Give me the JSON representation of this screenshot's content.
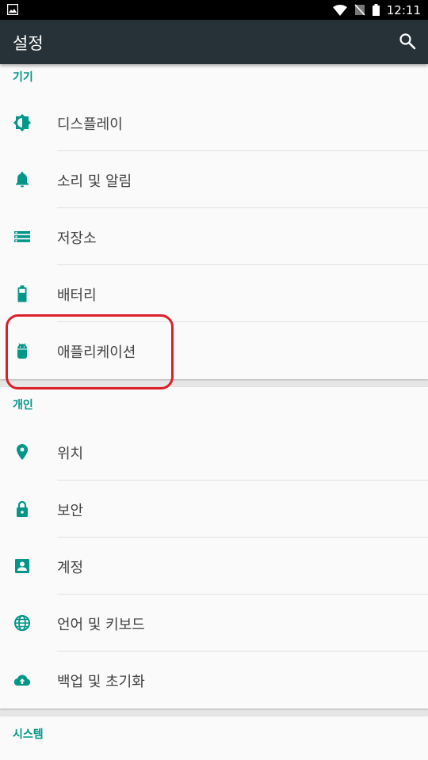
{
  "status_bar": {
    "time": "12:11",
    "icons": [
      "gallery-icon",
      "wifi-icon",
      "no-sim-icon",
      "battery-icon"
    ]
  },
  "toolbar": {
    "title": "설정",
    "search_icon": "search-icon"
  },
  "accent_color": "#009688",
  "sections": [
    {
      "title": "기기",
      "items": [
        {
          "label": "디스플레이",
          "icon": "brightness-icon"
        },
        {
          "label": "소리 및 알림",
          "icon": "bell-icon"
        },
        {
          "label": "저장소",
          "icon": "storage-icon"
        },
        {
          "label": "배터리",
          "icon": "battery-icon"
        },
        {
          "label": "애플리케이션",
          "icon": "android-icon"
        }
      ]
    },
    {
      "title": "개인",
      "items": [
        {
          "label": "위치",
          "icon": "location-icon"
        },
        {
          "label": "보안",
          "icon": "lock-icon"
        },
        {
          "label": "계정",
          "icon": "account-icon"
        },
        {
          "label": "언어 및 키보드",
          "icon": "globe-icon"
        },
        {
          "label": "백업 및 초기화",
          "icon": "cloud-upload-icon"
        }
      ]
    },
    {
      "title": "시스템",
      "items": []
    }
  ]
}
